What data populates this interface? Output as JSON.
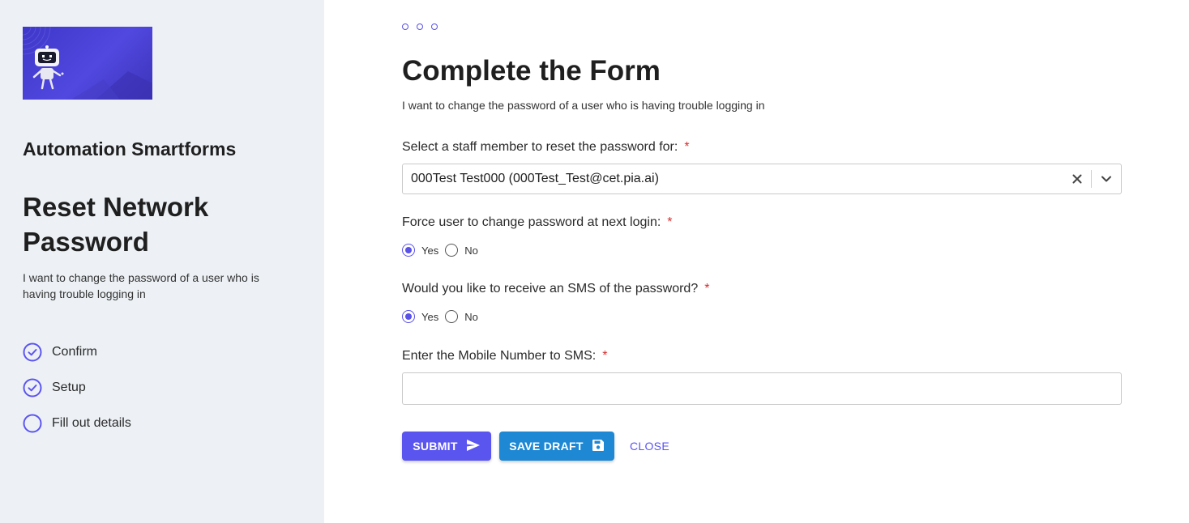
{
  "sidebar": {
    "app_name": "Automation Smartforms",
    "form_name": "Reset Network Password",
    "description": "I want to change the password of a user who is having trouble logging in",
    "steps": [
      {
        "label": "Confirm",
        "status": "complete",
        "icon": "check-circle-icon"
      },
      {
        "label": "Setup",
        "status": "complete",
        "icon": "check-circle-icon"
      },
      {
        "label": "Fill out details",
        "status": "current",
        "icon": "empty-circle-icon"
      }
    ]
  },
  "main": {
    "title": "Complete the Form",
    "subtitle": "I want to change the password of a user who is having trouble logging in",
    "fields": {
      "staff": {
        "label": "Select a staff member to reset the password for:",
        "required_mark": "*",
        "value": "000Test Test000 (000Test_Test@cet.pia.ai)"
      },
      "force_change": {
        "label": "Force user to change password at next login:",
        "required_mark": "*",
        "options": [
          "Yes",
          "No"
        ],
        "selected": "Yes"
      },
      "sms": {
        "label": "Would you like to receive an SMS of the password?",
        "required_mark": "*",
        "options": [
          "Yes",
          "No"
        ],
        "selected": "Yes"
      },
      "mobile": {
        "label": "Enter the Mobile Number to SMS:",
        "required_mark": "*",
        "value": "",
        "placeholder": ""
      }
    },
    "buttons": {
      "submit": "SUBMIT",
      "save_draft": "SAVE DRAFT",
      "close": "CLOSE"
    }
  },
  "colors": {
    "accent": "#5b55f0",
    "draft": "#1e88d4",
    "required": "#d32f2f",
    "sidebar_bg": "#edf1f5"
  }
}
